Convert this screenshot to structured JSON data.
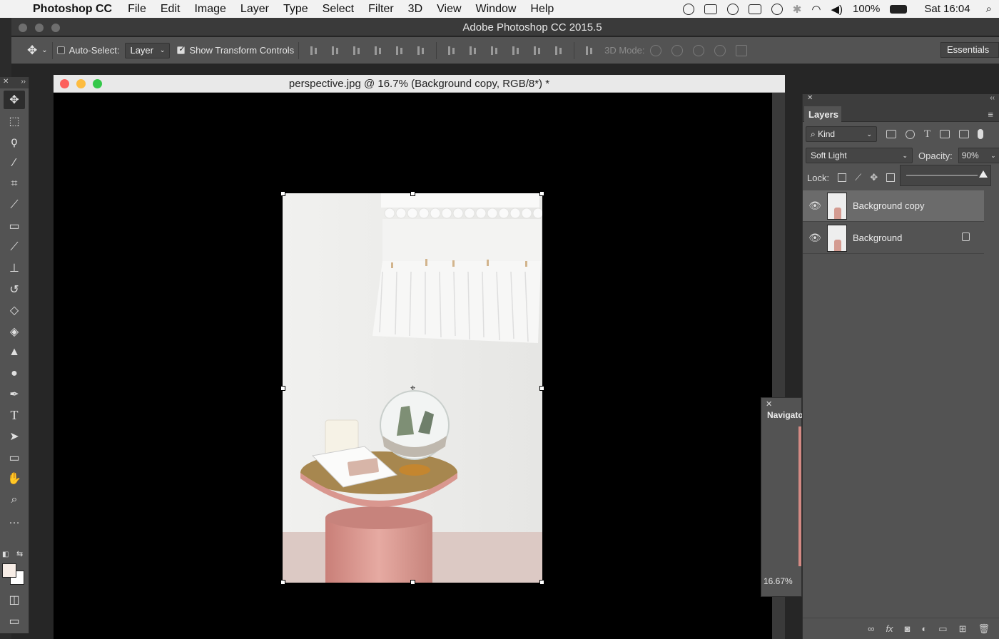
{
  "menubar": {
    "app_name": "Photoshop CC",
    "items": [
      "File",
      "Edit",
      "Image",
      "Layer",
      "Type",
      "Select",
      "Filter",
      "3D",
      "View",
      "Window",
      "Help"
    ],
    "battery": "100%",
    "clock": "Sat 16:04"
  },
  "window": {
    "title": "Adobe Photoshop CC 2015.5"
  },
  "options": {
    "auto_select_label": "Auto-Select:",
    "auto_select_checked": false,
    "auto_select_target": "Layer",
    "show_transform_label": "Show Transform Controls",
    "show_transform_checked": true,
    "mode_3d_label": "3D Mode:",
    "workspace": "Essentials"
  },
  "document": {
    "title": "perspective.jpg @ 16.7% (Background copy, RGB/8*) *"
  },
  "navigator": {
    "title": "Navigator",
    "zoom": "16.67%"
  },
  "layers_panel": {
    "tab": "Layers",
    "filter_kind": "Kind",
    "blend_mode": "Soft Light",
    "opacity_label": "Opacity:",
    "opacity_value": "90%",
    "opacity_fraction": 0.9,
    "lock_label": "Lock:",
    "layers": [
      {
        "name": "Background copy",
        "visible": true,
        "selected": true,
        "locked": false
      },
      {
        "name": "Background",
        "visible": true,
        "selected": false,
        "locked": true
      }
    ]
  },
  "colors": {
    "panel": "#535353",
    "canvas_bg": "#000000",
    "foreground_swatch": "#f7ede6",
    "background_swatch": "#ffffff"
  }
}
